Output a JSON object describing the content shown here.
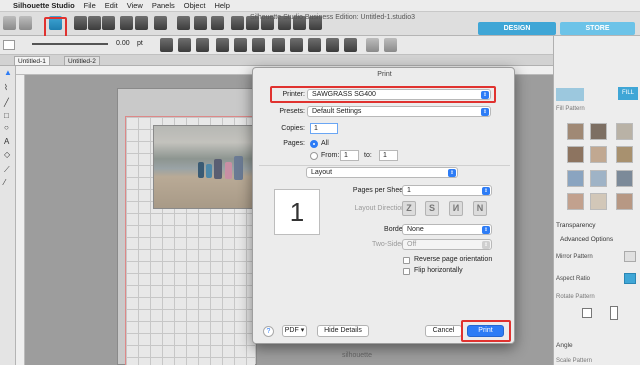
{
  "menubar": {
    "app": "Silhouette Studio",
    "items": [
      "File",
      "Edit",
      "View",
      "Panels",
      "Object",
      "Help"
    ]
  },
  "window_title": "Silhouette Studio Business Edition: Untitled-1.studio3",
  "top_tabs": {
    "design": "DESIGN",
    "store": "STORE"
  },
  "toolbar2": {
    "stroke_value": "0.00",
    "stroke_unit": "pt"
  },
  "doc_tabs": [
    "Untitled-1",
    "Untitled-2"
  ],
  "watermark": "silhouette",
  "right_panel": {
    "fill_label": "FILL",
    "fill_pattern": "Fill Pattern",
    "transparency": "Transparency",
    "advanced": "Advanced Options",
    "mirror": "Mirror Pattern",
    "aspect": "Aspect Ratio",
    "rotate": "Rotate Pattern",
    "angle": "Angle",
    "scale": "Scale Pattern"
  },
  "print_dialog": {
    "title": "Print",
    "printer_label": "Printer:",
    "printer_value": "SAWGRASS SG400",
    "presets_label": "Presets:",
    "presets_value": "Default Settings",
    "copies_label": "Copies:",
    "copies_value": "1",
    "pages_label": "Pages:",
    "pages_all": "All",
    "pages_from": "From:",
    "from_value": "1",
    "to_label": "to:",
    "to_value": "1",
    "section_value": "Layout",
    "preview_number": "1",
    "pages_per_sheet_label": "Pages per Sheet:",
    "pages_per_sheet_value": "1",
    "layout_direction_label": "Layout Direction:",
    "border_label": "Border:",
    "border_value": "None",
    "two_sided_label": "Two-Sided:",
    "two_sided_value": "Off",
    "reverse_label": "Reverse page orientation",
    "flip_label": "Flip horizontally",
    "help_label": "?",
    "pdf_label": "PDF",
    "hide_details": "Hide Details",
    "cancel": "Cancel",
    "print": "Print"
  }
}
